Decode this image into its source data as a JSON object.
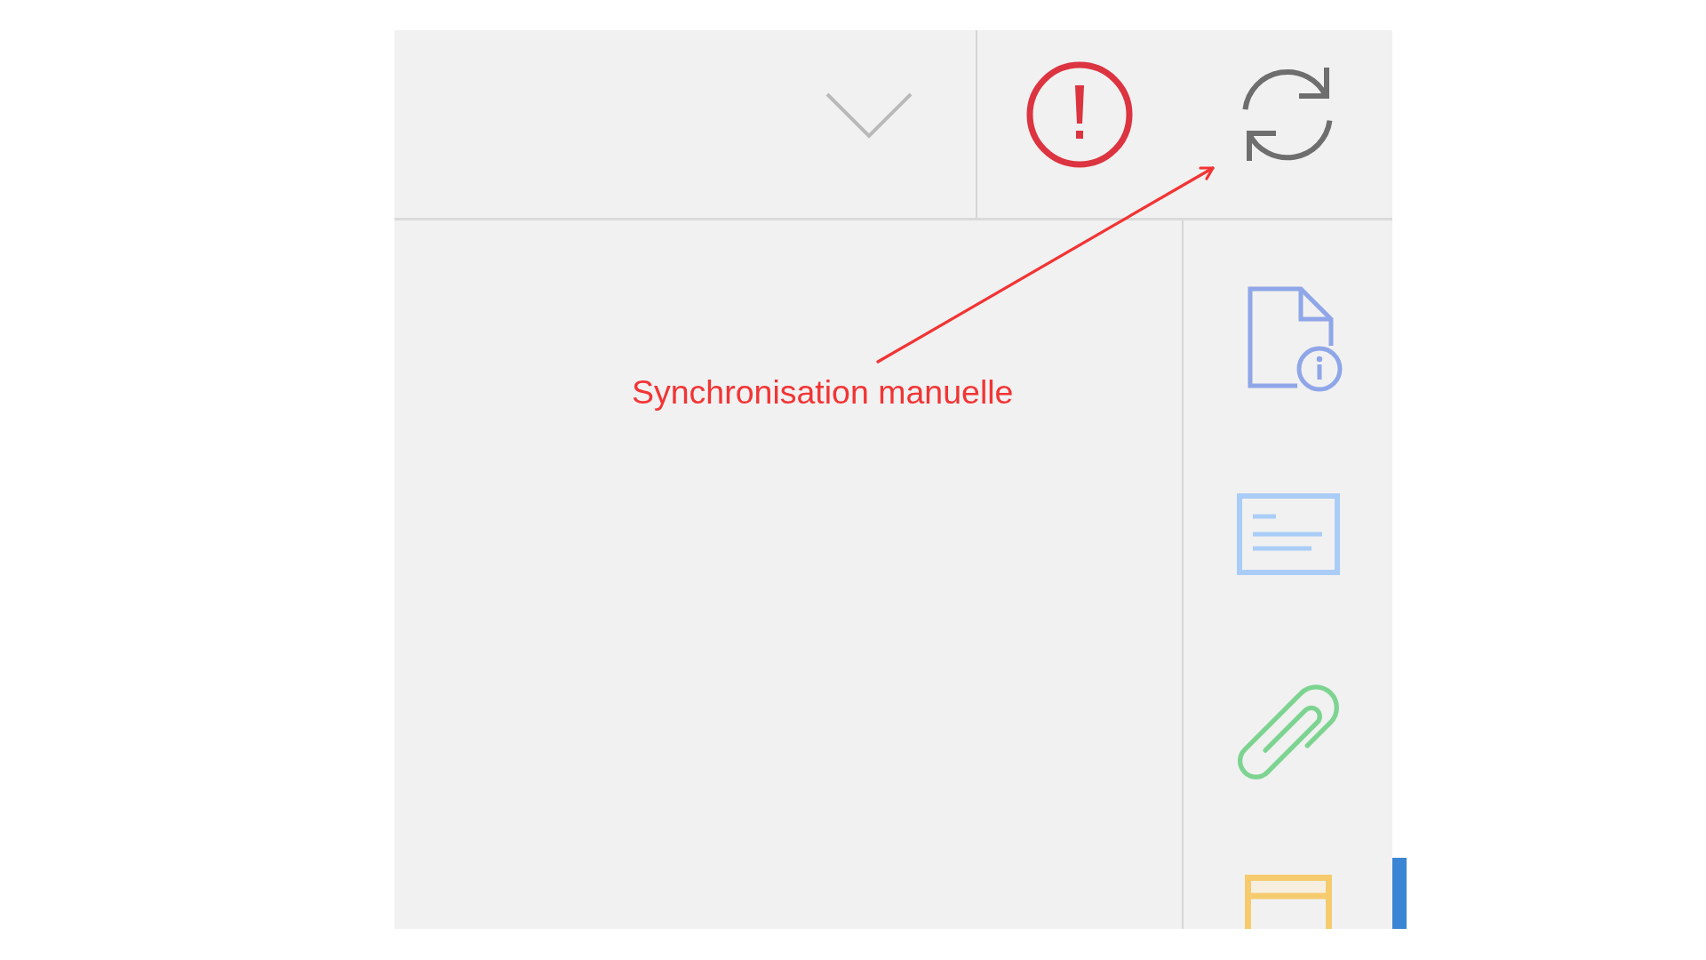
{
  "toolbar": {
    "buttons": [
      {
        "kind": "alert"
      },
      {
        "kind": "sync"
      }
    ]
  },
  "sidebar": {
    "items": [
      {
        "kind": "document-info",
        "selected": false
      },
      {
        "kind": "card",
        "selected": false
      },
      {
        "kind": "attachment",
        "selected": false
      },
      {
        "kind": "panel",
        "selected": true
      }
    ]
  },
  "annotation": {
    "text": "Synchronisation manuelle"
  }
}
